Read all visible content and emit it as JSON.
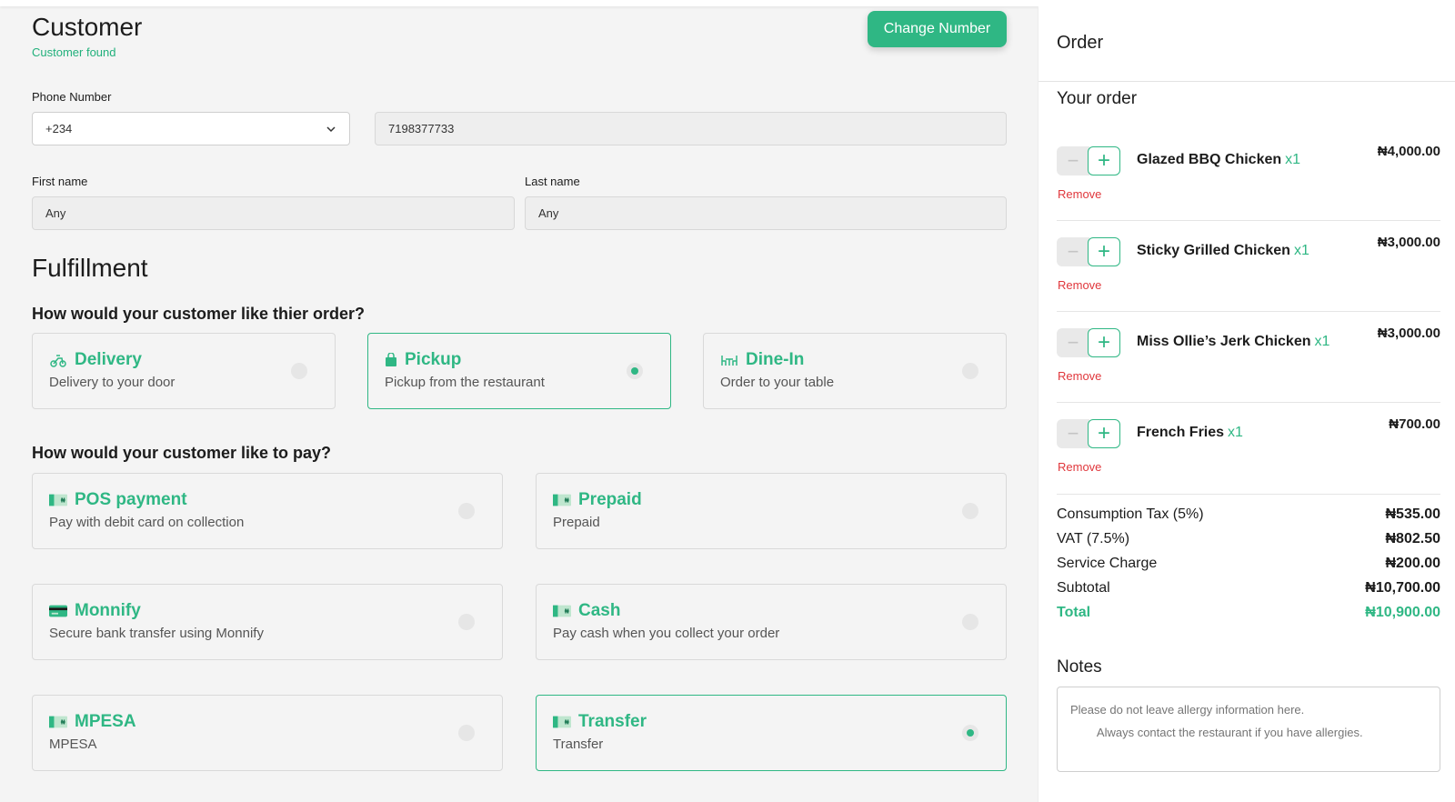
{
  "customer": {
    "title": "Customer",
    "status": "Customer found",
    "change_button": "Change Number",
    "phone_label": "Phone Number",
    "country_code": "+234",
    "phone_value": "7198377733",
    "first_name_label": "First name",
    "first_name_value": "Any",
    "last_name_label": "Last name",
    "last_name_value": "Any"
  },
  "fulfillment": {
    "title": "Fulfillment",
    "question": "How would your customer like thier order?",
    "options": [
      {
        "title": "Delivery",
        "subtitle": "Delivery to your door",
        "icon": "scooter-icon",
        "selected": false
      },
      {
        "title": "Pickup",
        "subtitle": "Pickup from the restaurant",
        "icon": "bag-icon",
        "selected": true
      },
      {
        "title": "Dine-In",
        "subtitle": "Order to your table",
        "icon": "dining-table-icon",
        "selected": false
      }
    ]
  },
  "payment": {
    "question": "How would your customer like to pay?",
    "options": [
      {
        "title": "POS payment",
        "subtitle": "Pay with debit card on collection",
        "icon": "naira-note-icon",
        "selected": false
      },
      {
        "title": "Prepaid",
        "subtitle": "Prepaid",
        "icon": "naira-note-icon",
        "selected": false
      },
      {
        "title": "Monnify",
        "subtitle": "Secure bank transfer using Monnify",
        "icon": "credit-card-icon",
        "selected": false
      },
      {
        "title": "Cash",
        "subtitle": "Pay cash when you collect your order",
        "icon": "naira-note-icon",
        "selected": false
      },
      {
        "title": "MPESA",
        "subtitle": "MPESA",
        "icon": "naira-note-icon",
        "selected": false
      },
      {
        "title": "Transfer",
        "subtitle": "Transfer",
        "icon": "naira-note-icon",
        "selected": true
      }
    ]
  },
  "order": {
    "title": "Order",
    "subtitle": "Your order",
    "minus": "−",
    "plus": "+",
    "remove_label": "Remove",
    "items": [
      {
        "name": "Glazed BBQ Chicken",
        "qty": "x1",
        "price": "₦4,000.00"
      },
      {
        "name": "Sticky Grilled Chicken",
        "qty": "x1",
        "price": "₦3,000.00"
      },
      {
        "name": "Miss Ollie’s Jerk Chicken",
        "qty": "x1",
        "price": "₦3,000.00"
      },
      {
        "name": "French Fries",
        "qty": "x1",
        "price": "₦700.00"
      }
    ],
    "summary": [
      {
        "label": "Consumption Tax (5%)",
        "value": "₦535.00"
      },
      {
        "label": "VAT (7.5%)",
        "value": "₦802.50"
      },
      {
        "label": "Service Charge",
        "value": "₦200.00"
      },
      {
        "label": "Subtotal",
        "value": "₦10,700.00"
      }
    ],
    "total": {
      "label": "Total",
      "value": "₦10,900.00"
    },
    "notes_label": "Notes",
    "notes_placeholder": "Please do not leave allergy information here.\n        Always contact the restaurant if you have allergies."
  },
  "colors": {
    "accent": "#2fb784",
    "danger": "#e0373c"
  }
}
